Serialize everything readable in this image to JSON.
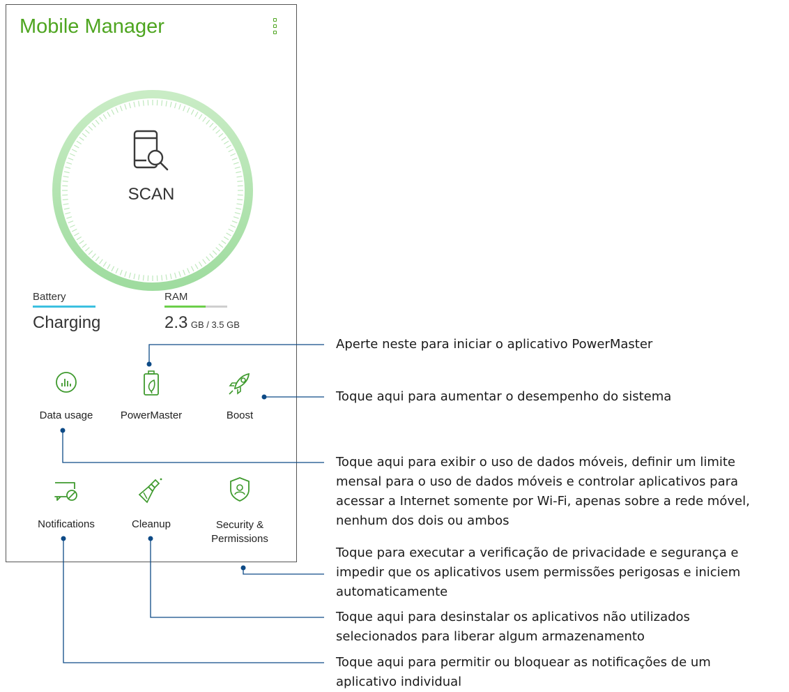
{
  "app": {
    "title": "Mobile Manager",
    "menu_icon": "more-vert-icon"
  },
  "scan": {
    "label": "SCAN",
    "icon": "phone-search-icon"
  },
  "stats": {
    "battery": {
      "label": "Battery",
      "value": "Charging"
    },
    "ram": {
      "label": "RAM",
      "used": "2.3",
      "detail": "GB / 3.5 GB",
      "fraction": 0.657
    }
  },
  "tiles": {
    "data_usage": {
      "label": "Data usage",
      "icon": "data-usage-icon"
    },
    "powermaster": {
      "label": "PowerMaster",
      "icon": "battery-leaf-icon"
    },
    "boost": {
      "label": "Boost",
      "icon": "rocket-icon"
    },
    "notifications": {
      "label": "Notifications",
      "icon": "notification-blocked-icon"
    },
    "cleanup": {
      "label": "Cleanup",
      "icon": "broom-icon"
    },
    "security": {
      "label_line1": "Security &",
      "label_line2": "Permissions",
      "icon": "shield-user-icon"
    }
  },
  "callouts": {
    "powermaster": [
      "Aperte neste para iniciar o aplicativo PowerMaster"
    ],
    "boost": [
      "Toque aqui para aumentar o desempenho do sistema"
    ],
    "data_usage": [
      "Toque aqui para exibir o uso de dados móveis, definir um limite",
      "mensal para o uso de dados móveis e controlar aplicativos para",
      "acessar a Internet somente por Wi-Fi, apenas sobre a rede móvel,",
      "nenhum dos dois ou ambos"
    ],
    "security": [
      "Toque para executar a verificação de privacidade e segurança e",
      "impedir que os aplicativos usem permissões perigosas e iniciem",
      "automaticamente"
    ],
    "cleanup": [
      "Toque aqui para desinstalar os aplicativos não utilizados",
      "selecionados para liberar algum armazenamento"
    ],
    "notifications": [
      "Toque aqui para permitir ou bloquear as notificações de um",
      "aplicativo individual"
    ]
  },
  "colors": {
    "brand_green": "#4ea520",
    "ring_green": "#a7dfa7",
    "icon_green": "#3f9a2e",
    "battery_blue": "#3cc0e0",
    "ram_green": "#6ccf4a",
    "callout_blue": "#0d4a86"
  }
}
